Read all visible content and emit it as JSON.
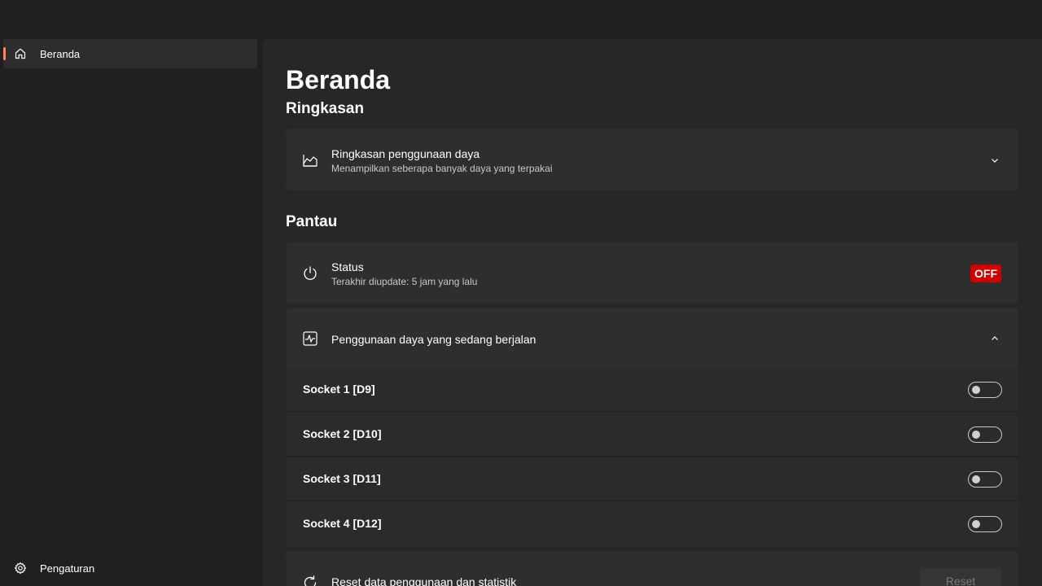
{
  "nav": {
    "items": [
      {
        "label": "Beranda",
        "icon": "home-icon",
        "selected": true
      }
    ],
    "footer": {
      "label": "Pengaturan",
      "icon": "gear-icon"
    },
    "accent": "#f08c65"
  },
  "page": {
    "title": "Beranda",
    "summary_section": "Ringkasan",
    "summary_card": {
      "title": "Ringkasan penggunaan daya",
      "subtitle": "Menampilkan seberapa banyak daya yang terpakai",
      "icon": "area-chart-icon"
    },
    "monitor_section": "Pantau",
    "status_card": {
      "title": "Status",
      "subtitle": "Terakhir diupdate: 5 jam yang lalu",
      "badge": "OFF",
      "badge_color": "#d10000",
      "icon": "power-icon"
    },
    "usage_card": {
      "title": "Penggunaan daya yang sedang berjalan",
      "icon": "activity-monitor-icon"
    },
    "sockets": [
      {
        "label": "Socket 1 [D9]",
        "on": false
      },
      {
        "label": "Socket 2 [D10]",
        "on": false
      },
      {
        "label": "Socket 3 [D11]",
        "on": false
      },
      {
        "label": "Socket 4 [D12]",
        "on": false
      }
    ],
    "reset_card": {
      "title": "Reset data penggunaan dan statistik",
      "button": "Reset",
      "icon": "refresh-icon"
    }
  }
}
